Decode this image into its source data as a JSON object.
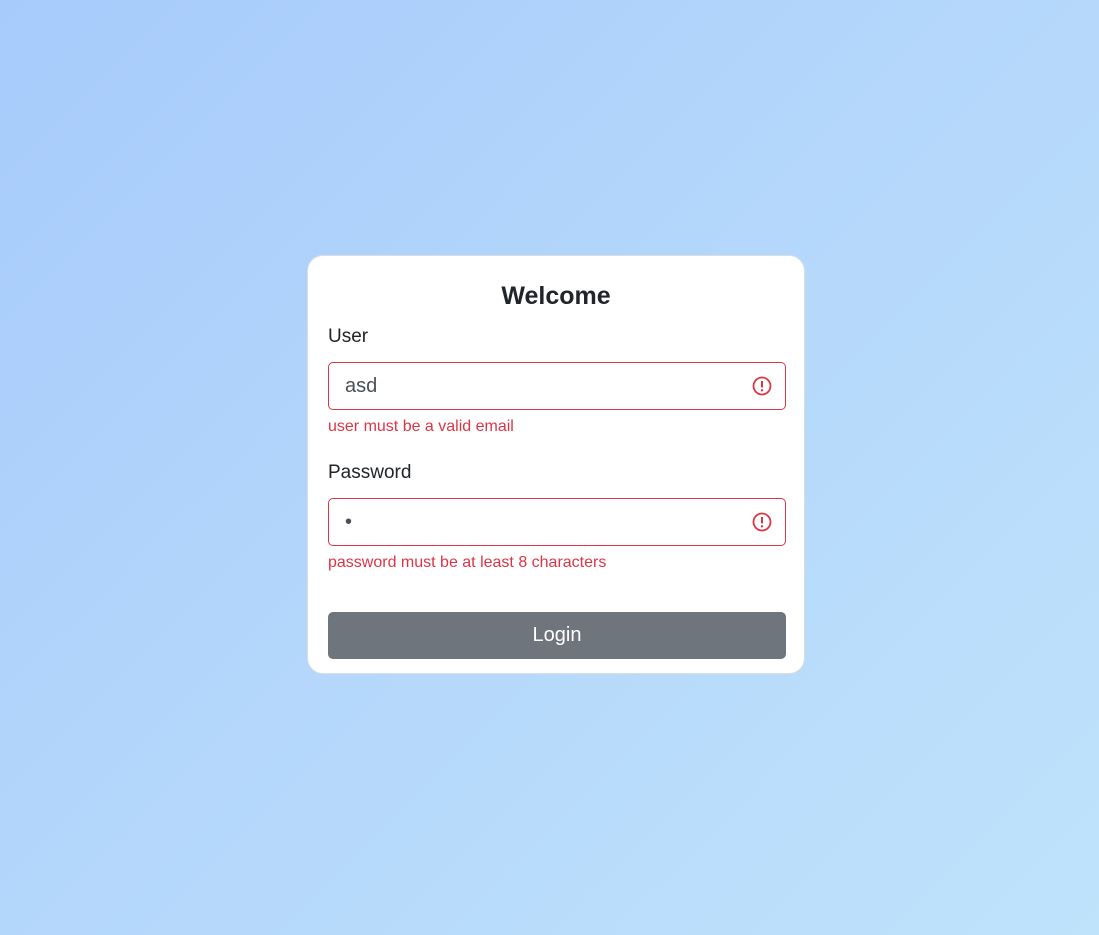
{
  "form": {
    "title": "Welcome",
    "user": {
      "label": "User",
      "value": "asd",
      "error": "user must be a valid email",
      "icon": "exclamation-circle-icon"
    },
    "password": {
      "label": "Password",
      "masked_value": "•",
      "error": "password must be at least 8 characters",
      "icon": "exclamation-circle-icon"
    },
    "login_label": "Login"
  },
  "colors": {
    "error": "#dc3545",
    "button": "#6f757d",
    "background_start": "#a7cbfb",
    "background_end": "#bfe3fb",
    "card": "#ffffff"
  }
}
